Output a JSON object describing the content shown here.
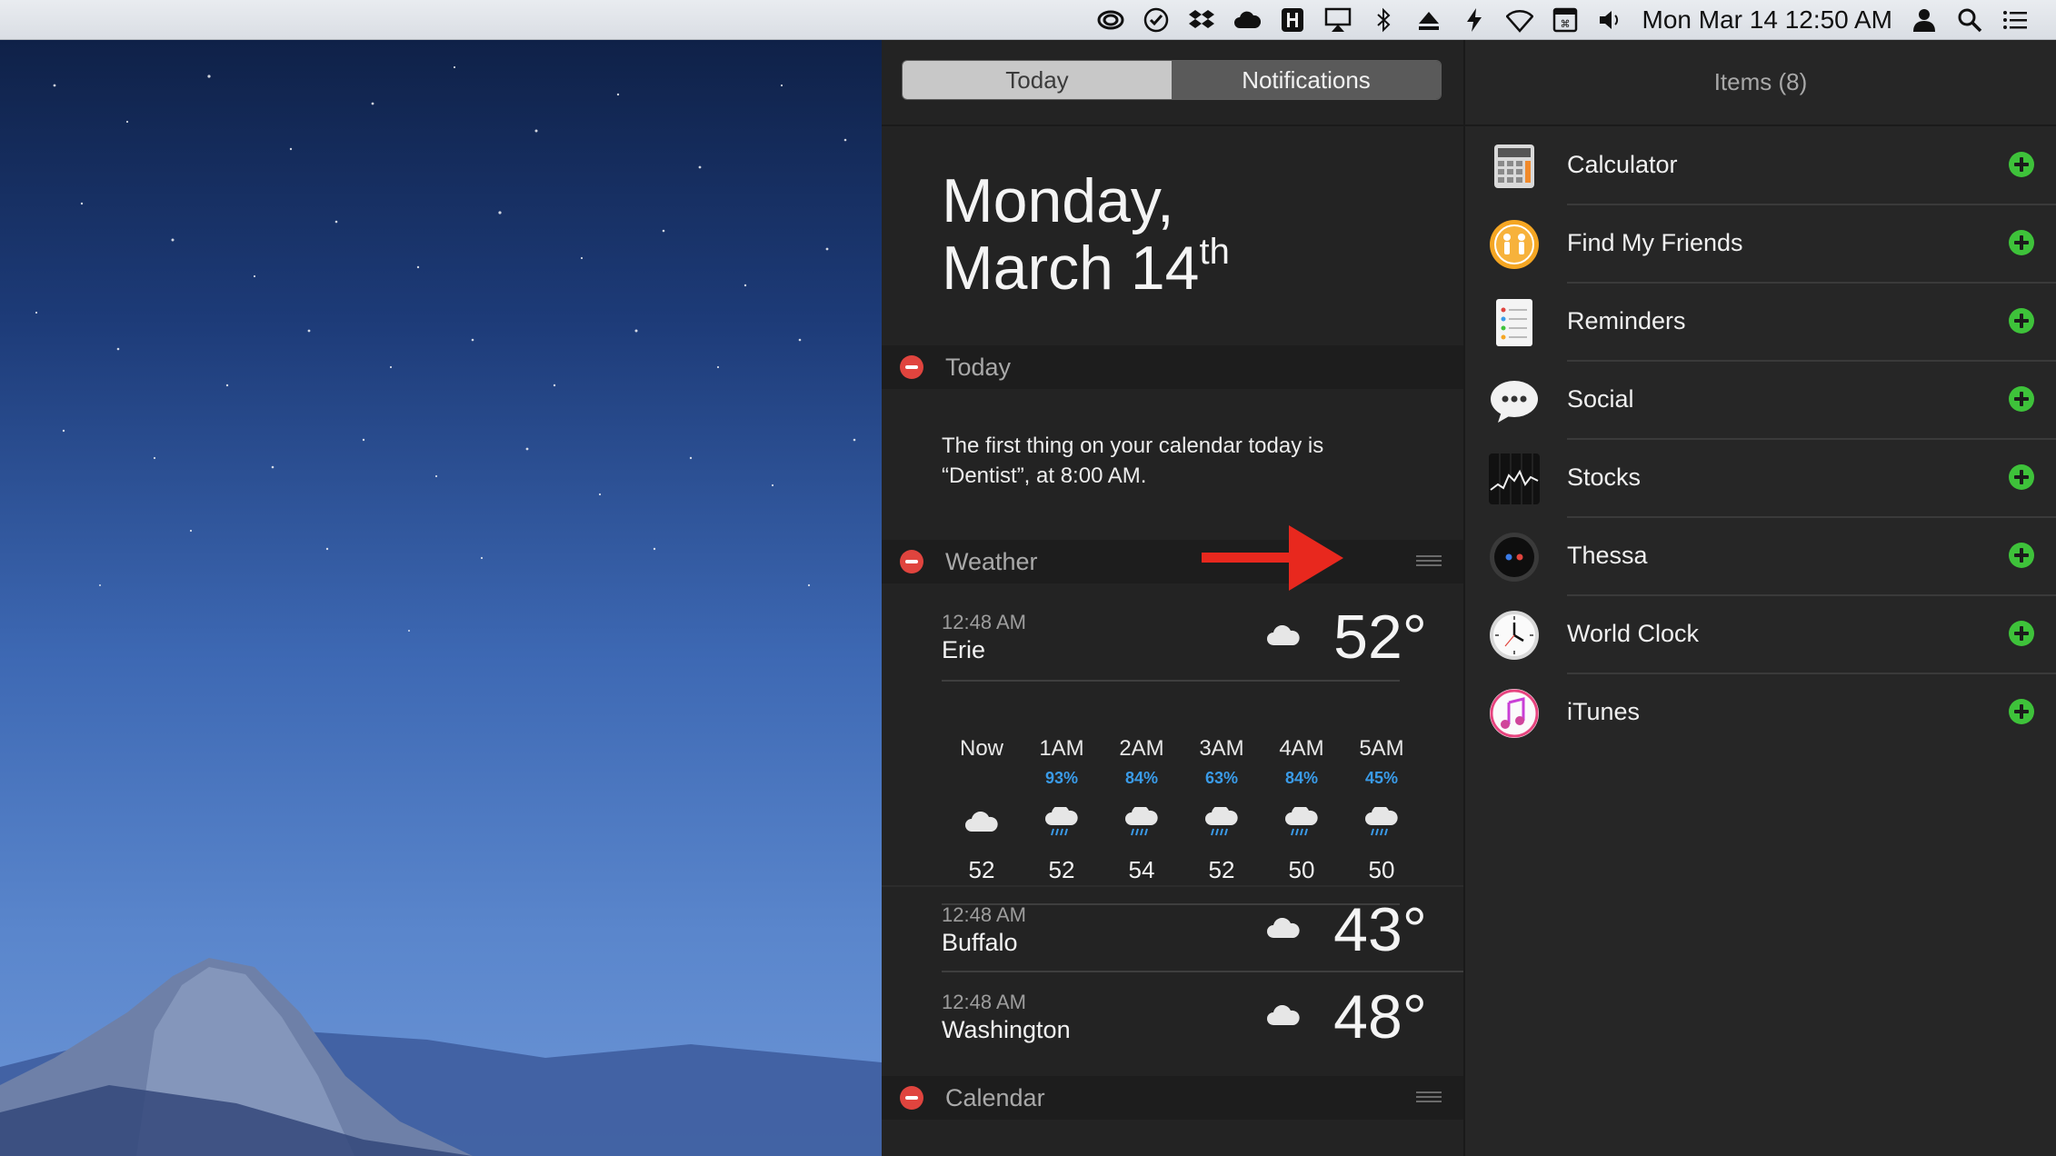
{
  "menubar": {
    "icons": [
      "creative-cloud-icon",
      "omnifocus-check-icon",
      "dropbox-icon",
      "cloud-icon",
      "app-h-icon",
      "airplay-icon",
      "bluetooth-icon",
      "eject-icon",
      "bolt-icon",
      "wifi-icon",
      "keyboard-icon",
      "volume-icon",
      "user-icon",
      "spotlight-search-icon",
      "notification-center-icon"
    ],
    "clock": "Mon Mar 14  12:50 AM"
  },
  "tabs": {
    "today": "Today",
    "notifications": "Notifications"
  },
  "date": {
    "line1": "Monday,",
    "line2": "March 14",
    "suffix": "th"
  },
  "sections": {
    "today": {
      "title": "Today",
      "text": "The first thing on your calendar today is “Dentist”, at 8:00 AM."
    },
    "weather": {
      "title": "Weather",
      "cities": [
        {
          "time": "12:48 AM",
          "name": "Erie",
          "temp": "52°",
          "icon": "cloud-icon"
        },
        {
          "time": "12:48 AM",
          "name": "Buffalo",
          "temp": "43°",
          "icon": "cloud-icon"
        },
        {
          "time": "12:48 AM",
          "name": "Washington",
          "temp": "48°",
          "icon": "cloud-icon"
        }
      ],
      "hourly": [
        {
          "label": "Now",
          "pct": "",
          "icon": "cloud-icon",
          "temp": "52"
        },
        {
          "label": "1AM",
          "pct": "93%",
          "icon": "rain-cloud-icon",
          "temp": "52"
        },
        {
          "label": "2AM",
          "pct": "84%",
          "icon": "rain-cloud-icon",
          "temp": "54"
        },
        {
          "label": "3AM",
          "pct": "63%",
          "icon": "rain-cloud-icon",
          "temp": "52"
        },
        {
          "label": "4AM",
          "pct": "84%",
          "icon": "rain-cloud-icon",
          "temp": "50"
        },
        {
          "label": "5AM",
          "pct": "45%",
          "icon": "rain-cloud-icon",
          "temp": "50"
        }
      ]
    },
    "calendar": {
      "title": "Calendar"
    }
  },
  "items": {
    "title": "Items (8)",
    "list": [
      {
        "label": "Calculator",
        "icon": "calculator-icon"
      },
      {
        "label": "Find My Friends",
        "icon": "find-my-friends-icon"
      },
      {
        "label": "Reminders",
        "icon": "reminders-icon"
      },
      {
        "label": "Social",
        "icon": "social-icon"
      },
      {
        "label": "Stocks",
        "icon": "stocks-icon"
      },
      {
        "label": "Thessa",
        "icon": "thessa-icon"
      },
      {
        "label": "World Clock",
        "icon": "world-clock-icon"
      },
      {
        "label": "iTunes",
        "icon": "itunes-icon"
      }
    ]
  },
  "colors": {
    "remove_red": "#e0443e",
    "add_green": "#3ec23a",
    "precip_blue": "#3a9be8",
    "annotation_arrow": "#e8281e"
  }
}
